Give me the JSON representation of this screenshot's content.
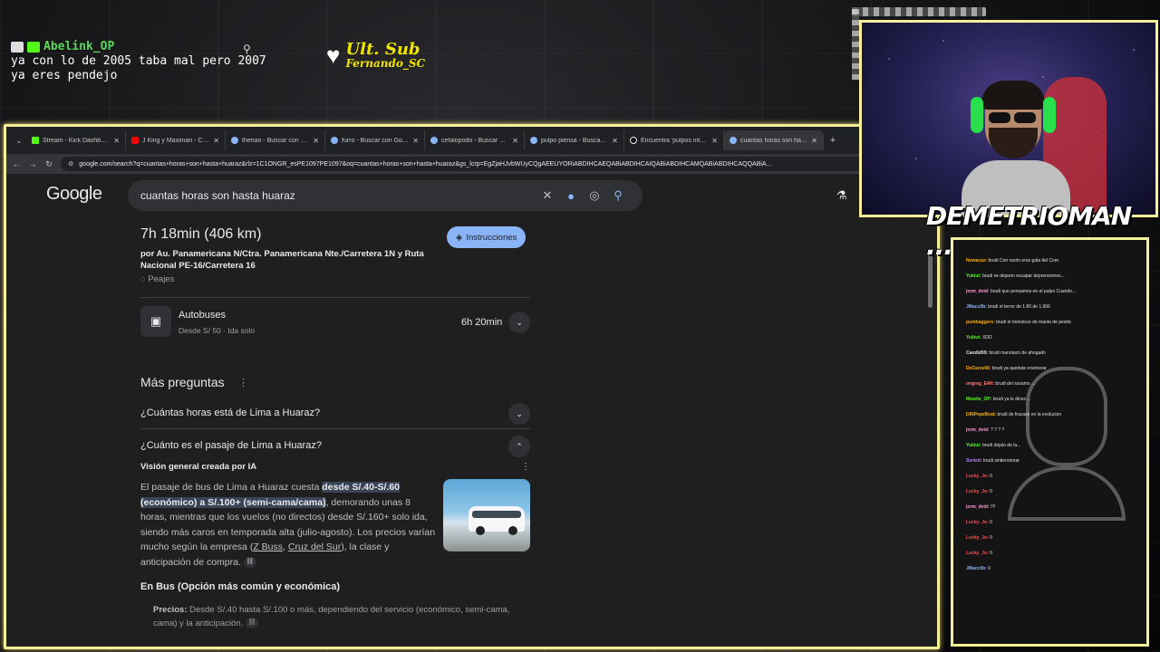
{
  "overlay": {
    "username": "Abelink_OP",
    "lines": [
      "ya con lo de 2005 taba mal pero 2007",
      "ya eres pendejo"
    ]
  },
  "sub_badge": {
    "title": "Ult. Sub",
    "name": "Fernando_SC"
  },
  "browser": {
    "tabs": [
      {
        "label": "Stream - Kick Dashboard",
        "icon": "kick"
      },
      {
        "label": "J King y Maximan - Cuan",
        "icon": "yt"
      },
      {
        "label": "therian - Buscar con Goo",
        "icon": "g"
      },
      {
        "label": "furro - Buscar con Goog",
        "icon": "g"
      },
      {
        "label": "cefalopodo - Buscar con",
        "icon": "g"
      },
      {
        "label": "pulpo piensa - Buscar co",
        "icon": "g"
      },
      {
        "label": "Encuentra 'pulpos intelig",
        "icon": "tt"
      },
      {
        "label": "cuantas horas son hasta",
        "icon": "g"
      }
    ],
    "url": "google.com/search?q=cuantas+horas+son+hasta+huaraz&rlz=1C1ONGR_esPE1097PE1097&oq=cuantas+horas+son+hasta+huaraz&gs_lcrp=EgZjaHJvbWUyCQgAEEUYORiABDIHCAEQABiABDIHCAIQABiABDIHCAMQABiABDIHCAQQABiA..."
  },
  "google": {
    "logo": "Google",
    "query": "cuantas horas son hasta huaraz",
    "route": {
      "time": "7h 18min (406 km)",
      "via": "por Au. Panamericana N/Ctra. Panamericana Nte./Carretera 1N y Ruta Nacional PE-16/Carretera 16",
      "toll": "Peajes",
      "instructions_btn": "Instrucciones"
    },
    "bus": {
      "title": "Autobuses",
      "sub": "Desde S/ 50 · Ida solo",
      "time": "6h 20min"
    },
    "more_questions": {
      "title": "Más preguntas",
      "q1": "¿Cuántas horas está de Lima a Huaraz?",
      "q2": "¿Cuánto es el pasaje de Lima a Huaraz?"
    },
    "ai": {
      "label": "Visión general creada por IA",
      "t1": "El pasaje de bus de Lima a Huaraz cuesta ",
      "hl": "desde S/.40-S/.60 (económico) a S/.100+ (semi-cama/cama)",
      "t2": ", demorando unas 8 horas, mientras que los vuelos (no directos) desde S/.160+ solo ida, siendo más caros en temporada alta (julio-agosto). Los precios varían mucho según la empresa (",
      "link1": "Z Buss",
      "sep": ", ",
      "link2": "Cruz del Sur",
      "t3": "), la clase y anticipación de compra."
    },
    "bus_section": {
      "title": "En Bus (Opción más común y económica)",
      "bullet_label": "Precios:",
      "bullet_text": " Desde S/.40 hasta S/.100 o más, dependiendo del servicio (económico, semi-cama, cama) y la anticipación."
    }
  },
  "webcam": {
    "streamer_name": "DEMETRIOMAN ..."
  },
  "chat": {
    "messages": [
      {
        "user": "Nowacaz:",
        "color": "#ffae00",
        "text": "brudi Con razón eres gala del Com"
      },
      {
        "user": "Yukiut:",
        "color": "#53fc18",
        "text": "brudi se dejaron escapar deprensiones..."
      },
      {
        "user": "jorm_dvid:",
        "color": "#ff9ad5",
        "text": "brudi que pensamos en el pulpo Cuando..."
      },
      {
        "user": "JMacclIb:",
        "color": "#8ab4f8",
        "text": "brudi el terror de 1.80 de 1.906"
      },
      {
        "user": "pumbaggers:",
        "color": "#ffae00",
        "text": "brudi el monstruo de manta de pesita"
      },
      {
        "user": "Yukiut:",
        "color": "#53fc18",
        "text": "XDD"
      },
      {
        "user": "Candid69:",
        "color": "#e0e0e0",
        "text": "brudi manotazo de ahogado"
      },
      {
        "user": "DeCares66:",
        "color": "#ffae00",
        "text": "brudi ya quedate enemorar"
      },
      {
        "user": "ongreg_E4H:",
        "color": "#ff7f7f",
        "text": "brudi del sosamo ..."
      },
      {
        "user": "Mowile_OP:",
        "color": "#53fc18",
        "text": "brudi ya le dices ..."
      },
      {
        "user": "DiNPepeBeat:",
        "color": "#ffae00",
        "text": "brudi de fracaso en la evolucion"
      },
      {
        "user": "jorm_dvid:",
        "color": "#ff9ad5",
        "text": "? ? ? ?"
      },
      {
        "user": "Yukiut:",
        "color": "#53fc18",
        "text": "brudi dejalo de la..."
      },
      {
        "user": "Sorted:",
        "color": "#bd7fff",
        "text": "brudi sintieronmar"
      },
      {
        "user": "Lucky_Jo:",
        "color": "#ff4d4d",
        "text": "0"
      },
      {
        "user": "Lucky_Jo:",
        "color": "#ff4d4d",
        "text": "0"
      },
      {
        "user": "jorm_dvid:",
        "color": "#ff9ad5",
        "text": "!!!!"
      },
      {
        "user": "Lucky_Jo:",
        "color": "#ff4d4d",
        "text": "0"
      },
      {
        "user": "Lucky_Jo:",
        "color": "#ff4d4d",
        "text": "0"
      },
      {
        "user": "Lucky_Jo:",
        "color": "#ff4d4d",
        "text": "0"
      },
      {
        "user": "JMacclIb:",
        "color": "#8ab4f8",
        "text": "0"
      }
    ]
  },
  "colors": {
    "frame": "#f5ef9a",
    "kick_green": "#53fc18",
    "google_bg": "#1f1f1f",
    "accent_blue": "#8ab4f8"
  }
}
